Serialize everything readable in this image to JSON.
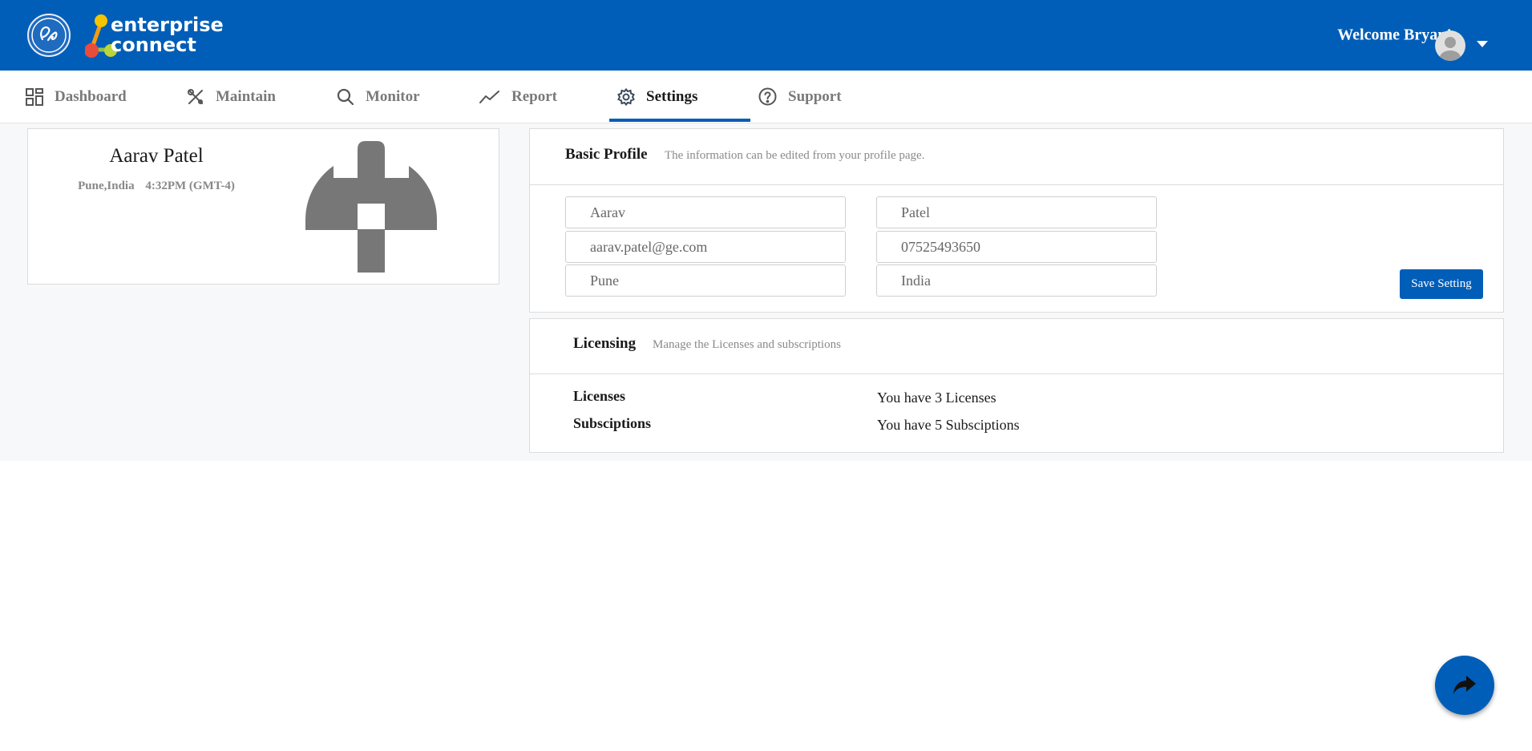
{
  "header": {
    "brand_line1": "enterprise",
    "brand_line2": "connect",
    "welcome": "Welcome Bryan!"
  },
  "nav": {
    "items": [
      {
        "label": "Dashboard",
        "icon": "dashboard-icon"
      },
      {
        "label": "Maintain",
        "icon": "tools-icon"
      },
      {
        "label": "Monitor",
        "icon": "search-icon"
      },
      {
        "label": "Report",
        "icon": "trend-icon"
      },
      {
        "label": "Settings",
        "icon": "gear-icon",
        "active": true
      },
      {
        "label": "Support",
        "icon": "help-icon"
      }
    ]
  },
  "profile": {
    "name": "Aarav Patel",
    "location": "Pune,India",
    "time": "4:32PM (GMT-4)"
  },
  "basic_profile": {
    "title": "Basic Profile",
    "subtitle": "The information can be edited from your profile page.",
    "fields": {
      "first_name": "Aarav",
      "last_name": "Patel",
      "email": "aarav.patel@ge.com",
      "phone": "07525493650",
      "city": "Pune",
      "country": "India"
    },
    "save_label": "Save Setting"
  },
  "licensing": {
    "title": "Licensing",
    "subtitle": "Manage the Licenses and subscriptions",
    "rows": [
      {
        "label": "Licenses",
        "value": "You have 3 Licenses"
      },
      {
        "label": "Subsciptions",
        "value": "You have 5 Subsciptions"
      }
    ]
  },
  "colors": {
    "brand_blue": "#005eb8",
    "page_bg": "#f7f8fa"
  }
}
